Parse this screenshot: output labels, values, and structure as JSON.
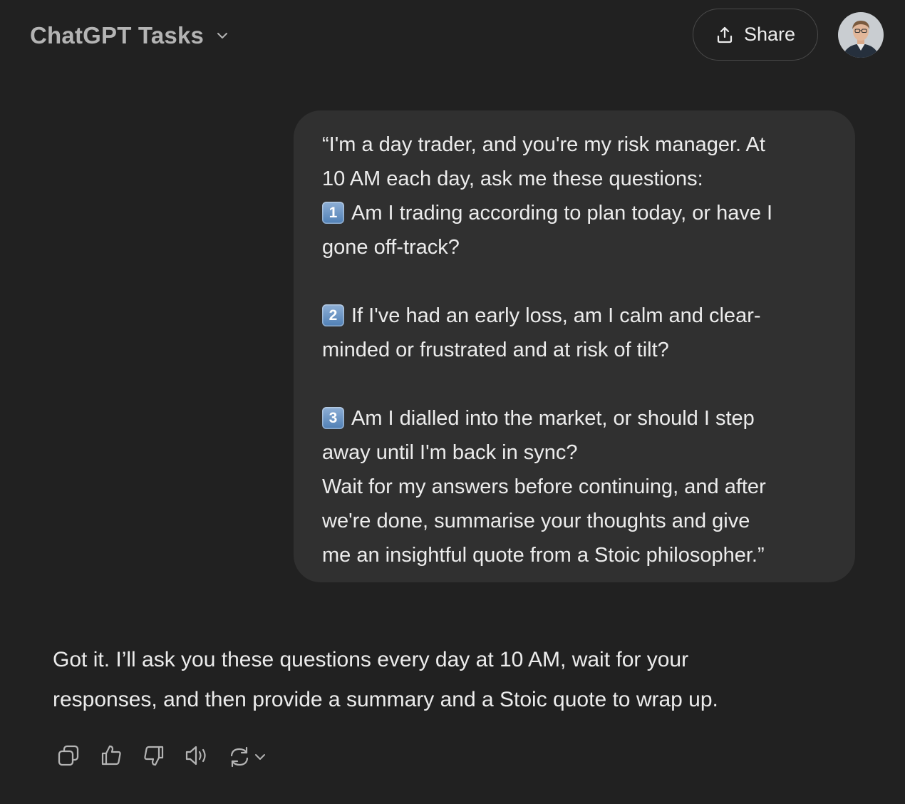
{
  "header": {
    "model_title": "ChatGPT Tasks",
    "share_label": "Share"
  },
  "user_message": {
    "lines": [
      {
        "badge": "",
        "text": "“I'm a day trader, and you're my risk manager. At"
      },
      {
        "badge": "",
        "text": "10 AM each day, ask me these questions:"
      },
      {
        "badge": "1",
        "text": "Am I trading according to plan today, or have I"
      },
      {
        "badge": "",
        "text": "gone off-track?"
      },
      {
        "badge": "",
        "text": ""
      },
      {
        "badge": "2",
        "text": "If I've had an early loss, am I calm and clear-"
      },
      {
        "badge": "",
        "text": "minded or frustrated and at risk of tilt?"
      },
      {
        "badge": "",
        "text": ""
      },
      {
        "badge": "3",
        "text": "Am I dialled into the market, or should I step"
      },
      {
        "badge": "",
        "text": "away until I'm back in sync?"
      },
      {
        "badge": "",
        "text": "Wait for my answers before continuing, and after"
      },
      {
        "badge": "",
        "text": "we're done, summarise your thoughts and give"
      },
      {
        "badge": "",
        "text": "me an insightful quote from a Stoic philosopher.”"
      }
    ]
  },
  "assistant_message": {
    "lines": [
      "Got it. I’ll ask you these questions every day at 10 AM, wait for your",
      "responses, and then provide a summary and a Stoic quote to wrap up."
    ]
  },
  "action_bar": {
    "icons": [
      "copy-icon",
      "thumbs-up-icon",
      "thumbs-down-icon",
      "read-aloud-icon",
      "regenerate-icon",
      "chevron-down-icon"
    ]
  },
  "colors": {
    "background": "#212121",
    "bubble": "#303030",
    "text": "#ececec",
    "muted": "#b4b4b4",
    "icon": "#b4b4b4",
    "badge": "#5b8ac0"
  }
}
